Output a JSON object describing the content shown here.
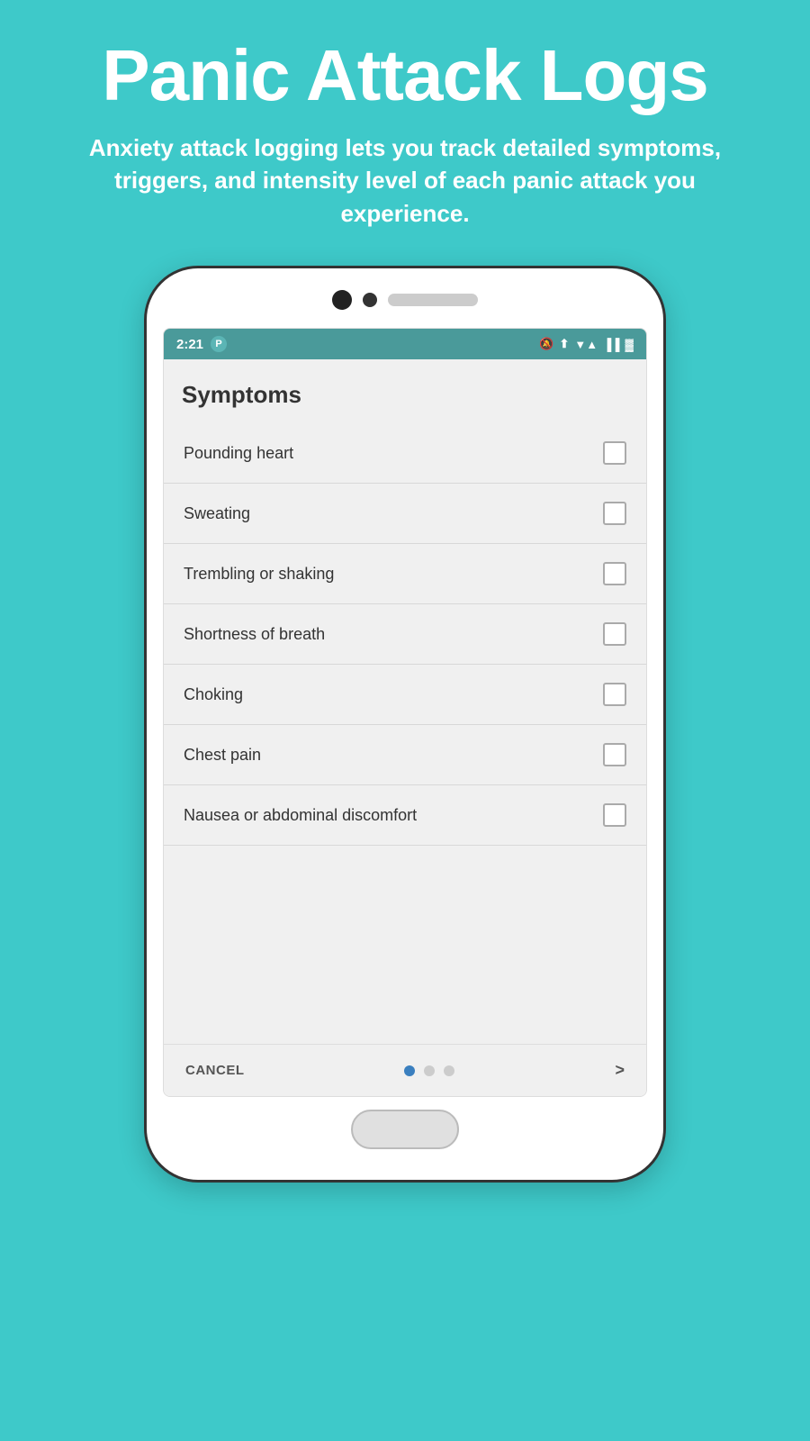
{
  "header": {
    "title": "Panic Attack Logs",
    "subtitle": "Anxiety attack logging lets you track detailed symptoms, triggers, and intensity level of each panic attack you experience."
  },
  "status_bar": {
    "time": "2:21",
    "p_icon": "P",
    "icons": "🔕 ⬆ ▼ ▲ 🔋"
  },
  "app": {
    "section_title": "Symptoms",
    "symptoms": [
      {
        "label": "Pounding heart",
        "checked": false
      },
      {
        "label": "Sweating",
        "checked": false
      },
      {
        "label": "Trembling or shaking",
        "checked": false
      },
      {
        "label": "Shortness of breath",
        "checked": false
      },
      {
        "label": "Choking",
        "checked": false
      },
      {
        "label": "Chest pain",
        "checked": false
      },
      {
        "label": "Nausea or abdominal discomfort",
        "checked": false
      }
    ],
    "bottom_nav": {
      "cancel_label": "CANCEL",
      "next_label": ">",
      "dots": [
        {
          "active": true
        },
        {
          "active": false
        },
        {
          "active": false
        }
      ]
    }
  }
}
